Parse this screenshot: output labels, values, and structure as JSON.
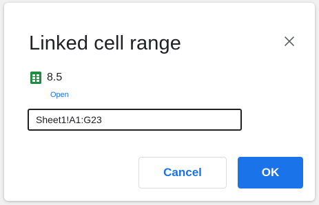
{
  "dialog": {
    "title": "Linked cell range",
    "close_icon": "close-icon"
  },
  "file": {
    "icon": "sheets-icon",
    "icon_color": "#1e8e3e",
    "name": "8.5",
    "open_label": "Open"
  },
  "range": {
    "value": "Sheet1!A1:G23"
  },
  "buttons": {
    "cancel_label": "Cancel",
    "ok_label": "OK"
  },
  "colors": {
    "accent": "#1a73e8",
    "text": "#202124"
  }
}
